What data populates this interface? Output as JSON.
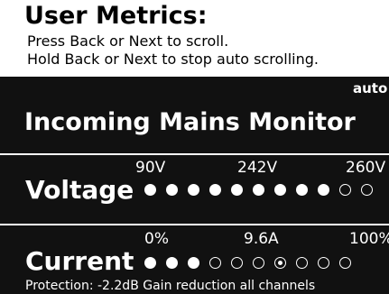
{
  "header": {
    "title": "User Metrics:",
    "instruction_1": "Press Back or Next to scroll.",
    "instruction_2": "Hold Back or Next to stop auto scrolling."
  },
  "screen": {
    "mode": "auto",
    "monitor_title": "Incoming Mains Monitor",
    "voltage": {
      "label": "Voltage",
      "ticks": [
        "90V",
        "242V",
        "260V"
      ],
      "leds_lit": 9,
      "leds_total": 11,
      "marker_index": null
    },
    "current": {
      "label": "Current",
      "ticks": [
        "0%",
        "9.6A",
        "100%"
      ],
      "leds_lit": 3,
      "leds_total": 10,
      "marker_index": 6
    },
    "protection": "Protection: -2.2dB Gain reduction all channels"
  },
  "colors": {
    "screen_background": "#111111",
    "screen_text": "#ffffff",
    "header_background": "#ffffff",
    "header_text": "#000000"
  }
}
